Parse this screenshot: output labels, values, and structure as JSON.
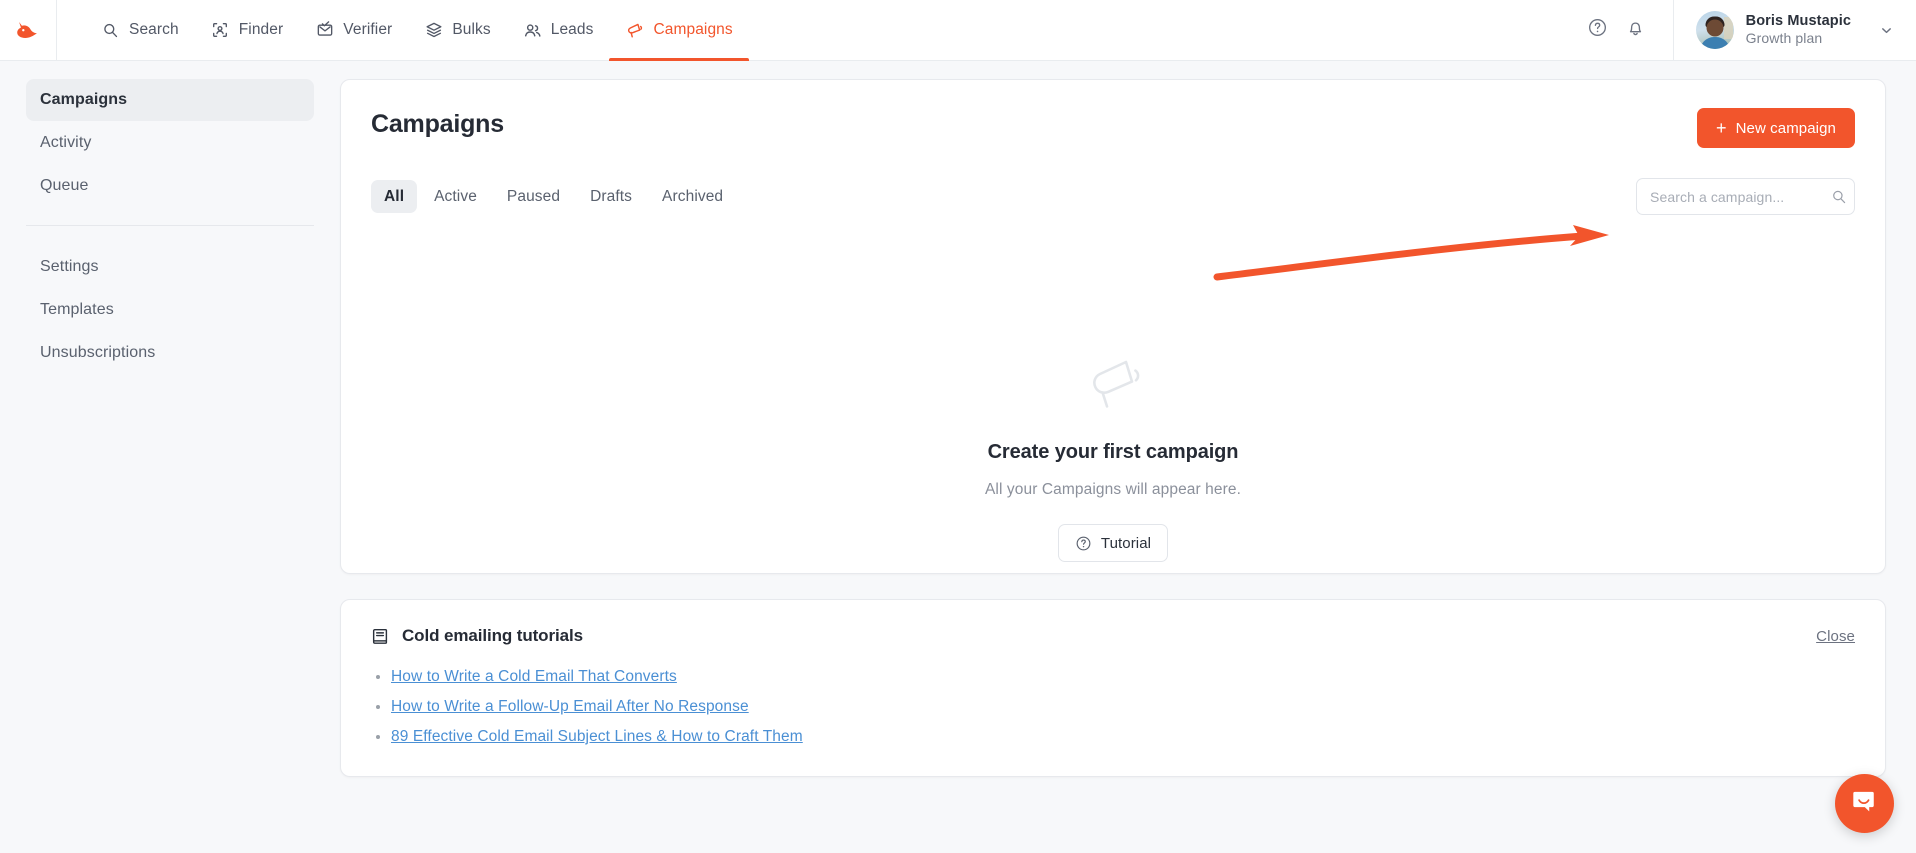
{
  "brand": {
    "accent": "#f2552c",
    "logo_icon": "hunter-fox-logo"
  },
  "topnav": {
    "items": [
      {
        "label": "Search",
        "icon": "magnifier-icon",
        "active": false
      },
      {
        "label": "Finder",
        "icon": "person-scan-icon",
        "active": false
      },
      {
        "label": "Verifier",
        "icon": "envelope-check-icon",
        "active": false
      },
      {
        "label": "Bulks",
        "icon": "layers-icon",
        "active": false
      },
      {
        "label": "Leads",
        "icon": "people-icon",
        "active": false
      },
      {
        "label": "Campaigns",
        "icon": "megaphone-icon",
        "active": true
      }
    ],
    "help_icon": "question-circle-icon",
    "notifications_icon": "bell-icon",
    "user": {
      "name": "Boris Mustapic",
      "plan": "Growth plan",
      "avatar": "user-avatar",
      "chevron": "chevron-down-icon"
    }
  },
  "sidebar": {
    "groups": [
      {
        "items": [
          {
            "label": "Campaigns",
            "active": true
          },
          {
            "label": "Activity",
            "active": false
          },
          {
            "label": "Queue",
            "active": false
          }
        ]
      },
      {
        "items": [
          {
            "label": "Settings",
            "active": false
          },
          {
            "label": "Templates",
            "active": false
          },
          {
            "label": "Unsubscriptions",
            "active": false
          }
        ]
      }
    ]
  },
  "main": {
    "title": "Campaigns",
    "new_campaign_button": "New campaign",
    "new_campaign_plus": "+",
    "tabs": [
      {
        "label": "All",
        "active": true
      },
      {
        "label": "Active",
        "active": false
      },
      {
        "label": "Paused",
        "active": false
      },
      {
        "label": "Drafts",
        "active": false
      },
      {
        "label": "Archived",
        "active": false
      }
    ],
    "search": {
      "placeholder": "Search a campaign...",
      "value": "",
      "icon": "search-icon"
    },
    "empty_state": {
      "icon": "megaphone-icon",
      "title": "Create your first campaign",
      "subtitle": "All your Campaigns will appear here.",
      "button_label": "Tutorial",
      "button_icon": "question-circle-icon"
    },
    "annotation": {
      "type": "arrow",
      "color": "#f2552c",
      "points_to": "new-campaign-button"
    }
  },
  "tutorials": {
    "icon": "book-icon",
    "title": "Cold emailing tutorials",
    "close_label": "Close",
    "links": [
      "How to Write a Cold Email That Converts",
      "How to Write a Follow-Up Email After No Response",
      "89 Effective Cold Email Subject Lines & How to Craft Them"
    ]
  },
  "chat_widget": {
    "icon": "chat-smile-icon",
    "color": "#f2552c"
  }
}
